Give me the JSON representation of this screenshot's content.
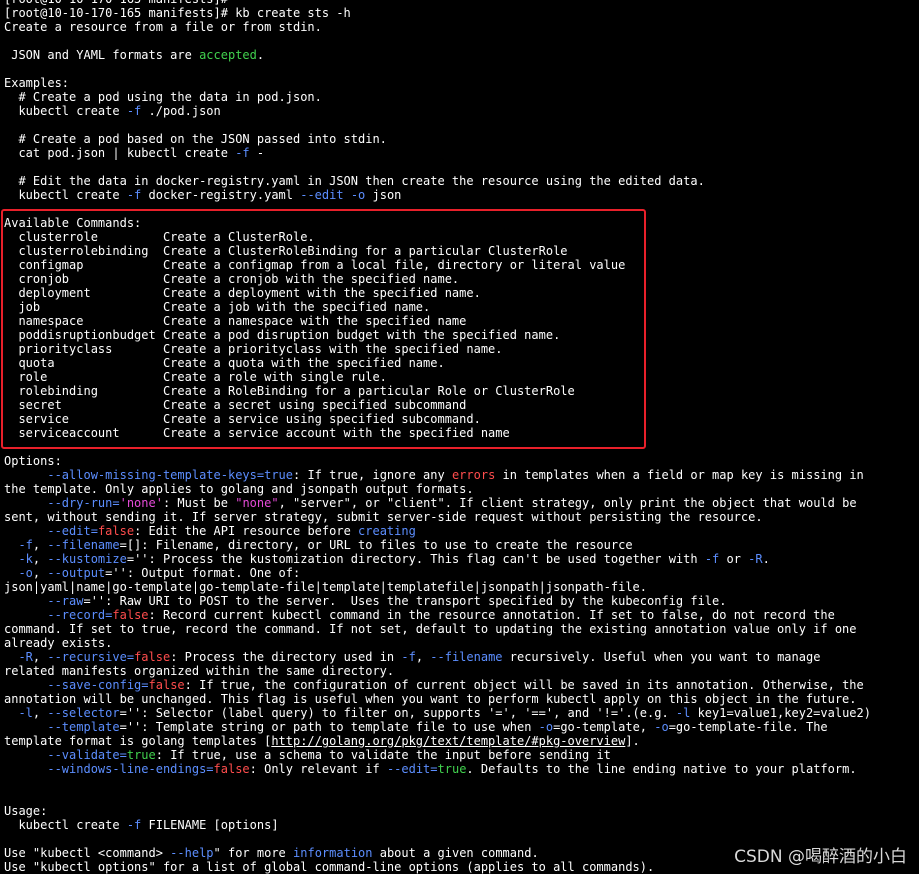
{
  "terminal": {
    "lines": [
      [
        {
          "t": "[root@10-10-170-165 manifests]#"
        }
      ],
      [
        {
          "t": "[root@10-10-170-165 manifests]# kb create sts -h"
        }
      ],
      [
        {
          "t": "Create a resource from a file or from stdin."
        }
      ],
      [
        {
          "t": ""
        }
      ],
      [
        {
          "t": " JSON and YAML formats are "
        },
        {
          "t": "accepted",
          "c": "g"
        },
        {
          "t": "."
        }
      ],
      [
        {
          "t": ""
        }
      ],
      [
        {
          "t": "Examples:"
        }
      ],
      [
        {
          "t": "  # Create a pod using the data in pod.json."
        }
      ],
      [
        {
          "t": "  kubectl create "
        },
        {
          "t": "-f",
          "c": "b"
        },
        {
          "t": " ./pod.json"
        }
      ],
      [
        {
          "t": ""
        }
      ],
      [
        {
          "t": "  # Create a pod based on the JSON passed into stdin."
        }
      ],
      [
        {
          "t": "  cat pod.json | kubectl create "
        },
        {
          "t": "-f",
          "c": "b"
        },
        {
          "t": " -"
        }
      ],
      [
        {
          "t": ""
        }
      ],
      [
        {
          "t": "  # Edit the data in docker-registry.yaml in JSON then create the resource using the edited data."
        }
      ],
      [
        {
          "t": "  kubectl create "
        },
        {
          "t": "-f",
          "c": "b"
        },
        {
          "t": " docker-registry.yaml "
        },
        {
          "t": "--edit",
          "c": "b"
        },
        {
          "t": " "
        },
        {
          "t": "-o",
          "c": "b"
        },
        {
          "t": " json"
        }
      ],
      [
        {
          "t": ""
        }
      ],
      [
        {
          "t": "Available Commands:"
        }
      ],
      [
        {
          "t": "  clusterrole         Create a ClusterRole."
        }
      ],
      [
        {
          "t": "  clusterrolebinding  Create a ClusterRoleBinding for a particular ClusterRole"
        }
      ],
      [
        {
          "t": "  configmap           Create a configmap from a local file, directory or literal value"
        }
      ],
      [
        {
          "t": "  cronjob             Create a cronjob with the specified name."
        }
      ],
      [
        {
          "t": "  deployment          Create a deployment with the specified name."
        }
      ],
      [
        {
          "t": "  job                 Create a job with the specified name."
        }
      ],
      [
        {
          "t": "  namespace           Create a namespace with the specified name"
        }
      ],
      [
        {
          "t": "  poddisruptionbudget Create a pod disruption budget with the specified name."
        }
      ],
      [
        {
          "t": "  priorityclass       Create a priorityclass with the specified name."
        }
      ],
      [
        {
          "t": "  quota               Create a quota with the specified name."
        }
      ],
      [
        {
          "t": "  role                Create a role with single rule."
        }
      ],
      [
        {
          "t": "  rolebinding         Create a RoleBinding for a particular Role or ClusterRole"
        }
      ],
      [
        {
          "t": "  secret              Create a secret using specified subcommand"
        }
      ],
      [
        {
          "t": "  service             Create a service using specified subcommand."
        }
      ],
      [
        {
          "t": "  serviceaccount      Create a service account with the specified name"
        }
      ],
      [
        {
          "t": ""
        }
      ],
      [
        {
          "t": "Options:"
        }
      ],
      [
        {
          "t": "      "
        },
        {
          "t": "--allow-missing-template-keys=true",
          "c": "b"
        },
        {
          "t": ": If true, ignore any "
        },
        {
          "t": "errors",
          "c": "r"
        },
        {
          "t": " in templates when a field or map key is missing in"
        }
      ],
      [
        {
          "t": "the template. Only applies to golang and jsonpath output formats."
        }
      ],
      [
        {
          "t": "      "
        },
        {
          "t": "--dry-run=",
          "c": "b"
        },
        {
          "t": "'none'",
          "c": "m"
        },
        {
          "t": ": Must be "
        },
        {
          "t": "\"none\"",
          "c": "m"
        },
        {
          "t": ", \"server\", or \"client\". If client strategy, only print the object that would be"
        }
      ],
      [
        {
          "t": "sent, without sending it. If server strategy, submit server-side request without persisting the resource."
        }
      ],
      [
        {
          "t": "      "
        },
        {
          "t": "--edit=",
          "c": "b"
        },
        {
          "t": "false",
          "c": "r"
        },
        {
          "t": ": Edit the API resource before "
        },
        {
          "t": "creating",
          "c": "b"
        }
      ],
      [
        {
          "t": "  "
        },
        {
          "t": "-f",
          "c": "b"
        },
        {
          "t": ", "
        },
        {
          "t": "--filename",
          "c": "b"
        },
        {
          "t": "=[]: Filename, directory, or URL to files to use to create the resource"
        }
      ],
      [
        {
          "t": "  "
        },
        {
          "t": "-k",
          "c": "b"
        },
        {
          "t": ", "
        },
        {
          "t": "--kustomize",
          "c": "b"
        },
        {
          "t": "='': Process the kustomization directory. This flag can't be used together with "
        },
        {
          "t": "-f",
          "c": "b"
        },
        {
          "t": " or "
        },
        {
          "t": "-R",
          "c": "b"
        },
        {
          "t": "."
        }
      ],
      [
        {
          "t": "  "
        },
        {
          "t": "-o",
          "c": "b"
        },
        {
          "t": ", "
        },
        {
          "t": "--output",
          "c": "b"
        },
        {
          "t": "='': Output format. One of:"
        }
      ],
      [
        {
          "t": "json|yaml|name|go-template|go-template-file|template|templatefile|jsonpath|jsonpath-file."
        }
      ],
      [
        {
          "t": "      "
        },
        {
          "t": "--raw",
          "c": "b"
        },
        {
          "t": "='': Raw URI to POST to the server.  Uses the transport specified by the kubeconfig file."
        }
      ],
      [
        {
          "t": "      "
        },
        {
          "t": "--record=",
          "c": "b"
        },
        {
          "t": "false",
          "c": "r"
        },
        {
          "t": ": Record current kubectl command in the resource annotation. If set to false, do not record the"
        }
      ],
      [
        {
          "t": "command. If set to true, record the command. If not set, default to updating the existing annotation value only if one"
        }
      ],
      [
        {
          "t": "already exists."
        }
      ],
      [
        {
          "t": "  "
        },
        {
          "t": "-R",
          "c": "b"
        },
        {
          "t": ", "
        },
        {
          "t": "--recursive=",
          "c": "b"
        },
        {
          "t": "false",
          "c": "r"
        },
        {
          "t": ": Process the directory used in "
        },
        {
          "t": "-f",
          "c": "b"
        },
        {
          "t": ", "
        },
        {
          "t": "--filename",
          "c": "b"
        },
        {
          "t": " recursively. Useful when you want to manage"
        }
      ],
      [
        {
          "t": "related manifests organized within the same directory."
        }
      ],
      [
        {
          "t": "      "
        },
        {
          "t": "--save-config=",
          "c": "b"
        },
        {
          "t": "false",
          "c": "r"
        },
        {
          "t": ": If true, the configuration of current object will be saved in its annotation. Otherwise, the"
        }
      ],
      [
        {
          "t": "annotation will be unchanged. This flag is useful when you want to perform kubectl apply on this object in the future."
        }
      ],
      [
        {
          "t": "  "
        },
        {
          "t": "-l",
          "c": "b"
        },
        {
          "t": ", "
        },
        {
          "t": "--selector",
          "c": "b"
        },
        {
          "t": "='': Selector (label query) to filter on, supports '=', '==', and '!='.(e.g. "
        },
        {
          "t": "-l",
          "c": "b"
        },
        {
          "t": " key1=value1,key2=value2)"
        }
      ],
      [
        {
          "t": "      "
        },
        {
          "t": "--template",
          "c": "b"
        },
        {
          "t": "='': Template string or path to template file to use when "
        },
        {
          "t": "-o",
          "c": "b"
        },
        {
          "t": "=go-template, "
        },
        {
          "t": "-o",
          "c": "b"
        },
        {
          "t": "=go-template-file. The"
        }
      ],
      [
        {
          "t": "template format is golang templates ["
        },
        {
          "t": "http://golang.org/pkg/text/template/#pkg-overview",
          "c": "u"
        },
        {
          "t": "]."
        }
      ],
      [
        {
          "t": "      "
        },
        {
          "t": "--validate=",
          "c": "b"
        },
        {
          "t": "true",
          "c": "g"
        },
        {
          "t": ": If true, use a schema to validate the input before sending it"
        }
      ],
      [
        {
          "t": "      "
        },
        {
          "t": "--windows-line-endings=",
          "c": "b"
        },
        {
          "t": "false",
          "c": "r"
        },
        {
          "t": ": Only relevant if "
        },
        {
          "t": "--edit=",
          "c": "b"
        },
        {
          "t": "true",
          "c": "g"
        },
        {
          "t": ". Defaults to the line ending native to your platform."
        }
      ],
      [
        {
          "t": ""
        }
      ],
      [
        {
          "t": ""
        }
      ],
      [
        {
          "t": "Usage:"
        }
      ],
      [
        {
          "t": "  kubectl create "
        },
        {
          "t": "-f",
          "c": "b"
        },
        {
          "t": " FILENAME [options]"
        }
      ],
      [
        {
          "t": ""
        }
      ],
      [
        {
          "t": "Use \"kubectl <command> "
        },
        {
          "t": "--help",
          "c": "b"
        },
        {
          "t": "\" for more "
        },
        {
          "t": "information",
          "c": "b"
        },
        {
          "t": " about a given command."
        }
      ],
      [
        {
          "t": "Use \"kubectl options\" for a list of global command-line options (applies to all commands)."
        }
      ]
    ]
  },
  "watermark": "CSDN @喝醉酒的小白",
  "colors": {
    "background": "#000000",
    "text": "#ffffff",
    "flag": "#5c8eff",
    "string": "#e64bd9",
    "false_error": "#ff4d4d",
    "true_accepted": "#41d14e",
    "highlight_box": "#e8202a"
  }
}
